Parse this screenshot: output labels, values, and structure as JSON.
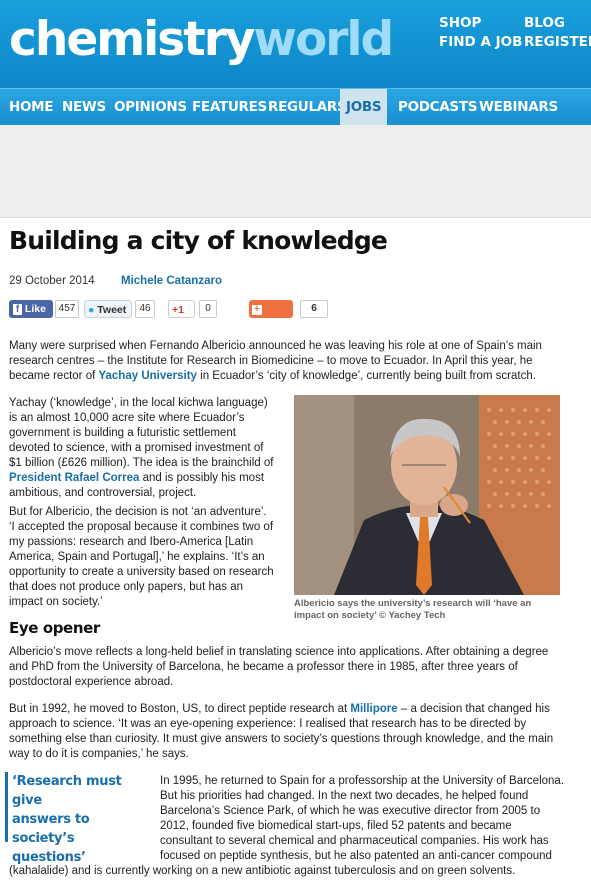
{
  "brand": {
    "logo_part1": "chemistry",
    "logo_part2": "world"
  },
  "top_links": {
    "shop": "SHOP",
    "find_a_job": "FIND A JOB",
    "blog": "BLOG",
    "register": "REGISTER"
  },
  "nav": {
    "items": [
      "HOME",
      "NEWS",
      "OPINIONS",
      "FEATURES",
      "REGULARS",
      "JOBS",
      "PODCASTS",
      "WEBINARS"
    ],
    "active": "JOBS"
  },
  "article": {
    "title": "Building a city of knowledge",
    "date": "29 October 2014",
    "author": "Michele Catanzaro",
    "share": {
      "like_label": "Like",
      "like_count": "457",
      "tweet_label": "Tweet",
      "tweet_count": "46",
      "gplus_label": "+1",
      "gplus_count": "0",
      "share_label": "Share",
      "share_count": "6"
    },
    "p1_lines": [
      "Many were surprised when Fernando Albericio announced he was leaving his role at one of Spain’s main",
      "research centres – the Institute for Research in Biomedicine – to move to Ecuador. In April this year, he"
    ],
    "p1_line3_pre": "became rector of ",
    "p1_link": "Yachay University",
    "p1_line3_post": " in Ecuador’s ‘city of knowledge’, currently being built from scratch.",
    "p2_lines": [
      "Yachay (‘knowledge’, in the local kichwa language)",
      "is an almost 10,000 acre site where Ecuador’s",
      "government is building a futuristic settlement",
      "devoted to science, with a promised investment of",
      "$1 billion (£626 million). The idea is the brainchild of"
    ],
    "p2_link": "President Rafael Correa",
    "p2_link_post": " and is possibly his most",
    "p2_last": "ambitious, and controversial, project.",
    "p3_lines": [
      "But for Albericio, the decision is not ‘an adventure’.",
      "‘I accepted the proposal because it combines two of",
      "my passions: research and Ibero-America [Latin",
      "America, Spain and Portugal],’ he explains. ‘It’s an",
      "opportunity to create a university based on research",
      "that does not produce only papers, but has an",
      "impact on society.’"
    ],
    "photo_caption_1": "Albericio says the university’s research will ‘have an",
    "photo_caption_2": "impact on society’ © Yachey Tech",
    "subhead": "Eye opener",
    "p4_lines": [
      "Albericio’s move reflects a long-held belief in translating science into applications. After obtaining a degree",
      "and PhD from the University of Barcelona, he became a professor there in 1985, after three years of",
      "postdoctoral experience abroad."
    ],
    "p5_line1_pre": "But in 1992, he moved to Boston, US, to direct peptide research at ",
    "p5_link": "Millipore",
    "p5_line1_post": " – a decision that changed his",
    "p5_lines": [
      "approach to science. ‘It was an eye-opening experience: I realised that research has to be directed by",
      "something else than curiosity. It must give answers to society’s questions through knowledge, and the main",
      "way to do it is companies,’ he says."
    ],
    "pull_quote": [
      "‘Research must give",
      "answers to society’s",
      "questions’"
    ],
    "p6_lines": [
      "In 1995, he returned to Spain for a professorship at the University of Barcelona.",
      "But his priorities had changed. In the next two decades, he helped found",
      "Barcelona’s Science Park, of which he was executive director from 2005 to",
      "2012, founded five biomedical start-ups, filed 52 patents and became",
      "consultant to several chemical and pharmaceutical companies. His work has",
      "focused on peptide synthesis, but he also patented an anti-cancer compound"
    ],
    "p6_last": "(kahalalide) and is currently working on a new antibiotic against tuberculosis and on green solvents."
  },
  "colors": {
    "header_blue": "#1196d6",
    "link_blue": "#1a6fa8",
    "active_tab": "#cfe3ef"
  }
}
